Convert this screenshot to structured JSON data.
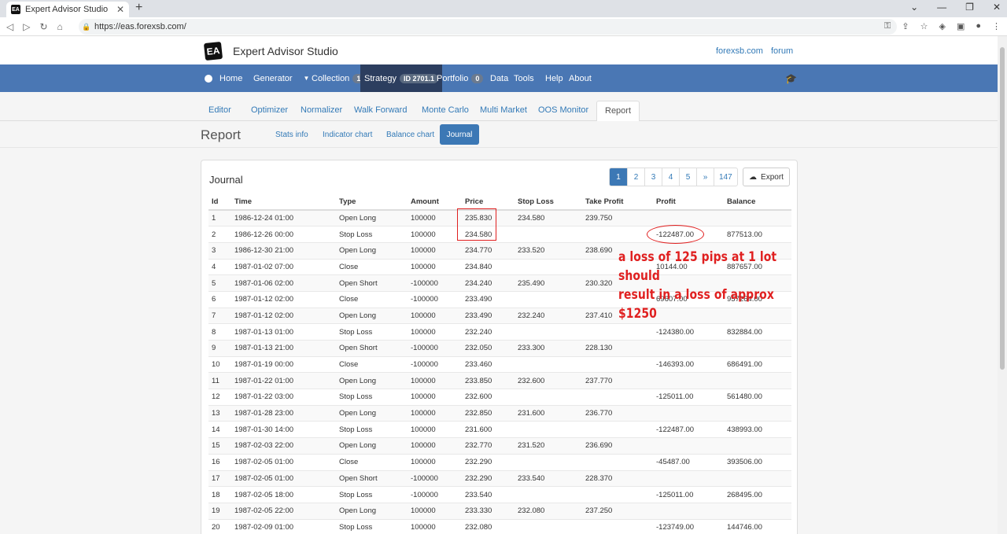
{
  "browser": {
    "tab_title": "Expert Advisor Studio",
    "tab_favicon": "EA",
    "url": "https://eas.forexsb.com/"
  },
  "header": {
    "logo_text": "EA",
    "app_title": "Expert Advisor Studio",
    "links": [
      "forexsb.com",
      "forum"
    ]
  },
  "nav": {
    "home": "Home",
    "generator": "Generator",
    "collection": "Collection",
    "collection_badge": "1",
    "strategy": "Strategy",
    "strategy_badge": "ID 2701.1",
    "portfolio": "Portfolio",
    "portfolio_badge": "0",
    "data": "Data",
    "tools": "Tools",
    "help": "Help",
    "about": "About"
  },
  "subtabs": [
    "Editor",
    "Optimizer",
    "Normalizer",
    "Walk Forward",
    "Monte Carlo",
    "Multi Market",
    "OOS Monitor",
    "Report"
  ],
  "report": {
    "title": "Report",
    "pills": [
      "Stats info",
      "Indicator chart",
      "Balance chart",
      "Journal"
    ]
  },
  "journal": {
    "title": "Journal",
    "pagination": [
      "1",
      "2",
      "3",
      "4",
      "5",
      "»",
      "147"
    ],
    "export_label": "Export",
    "columns": [
      "Id",
      "Time",
      "Type",
      "Amount",
      "Price",
      "Stop Loss",
      "Take Profit",
      "Profit",
      "Balance"
    ],
    "rows": [
      [
        "1",
        "1986-12-24 01:00",
        "Open Long",
        "100000",
        "235.830",
        "234.580",
        "239.750",
        "",
        ""
      ],
      [
        "2",
        "1986-12-26 00:00",
        "Stop Loss",
        "100000",
        "234.580",
        "",
        "",
        "-122487.00",
        "877513.00"
      ],
      [
        "3",
        "1986-12-30 21:00",
        "Open Long",
        "100000",
        "234.770",
        "233.520",
        "238.690",
        "",
        ""
      ],
      [
        "4",
        "1987-01-02 07:00",
        "Close",
        "100000",
        "234.840",
        "",
        "",
        "10144.00",
        "887657.00"
      ],
      [
        "5",
        "1987-01-06 02:00",
        "Open Short",
        "-100000",
        "234.240",
        "235.490",
        "230.320",
        "",
        ""
      ],
      [
        "6",
        "1987-01-12 02:00",
        "Close",
        "-100000",
        "233.490",
        "",
        "",
        "69607.00",
        "957264.00"
      ],
      [
        "7",
        "1987-01-12 02:00",
        "Open Long",
        "100000",
        "233.490",
        "232.240",
        "237.410",
        "",
        ""
      ],
      [
        "8",
        "1987-01-13 01:00",
        "Stop Loss",
        "100000",
        "232.240",
        "",
        "",
        "-124380.00",
        "832884.00"
      ],
      [
        "9",
        "1987-01-13 21:00",
        "Open Short",
        "-100000",
        "232.050",
        "233.300",
        "228.130",
        "",
        ""
      ],
      [
        "10",
        "1987-01-19 00:00",
        "Close",
        "-100000",
        "233.460",
        "",
        "",
        "-146393.00",
        "686491.00"
      ],
      [
        "11",
        "1987-01-22 01:00",
        "Open Long",
        "100000",
        "233.850",
        "232.600",
        "237.770",
        "",
        ""
      ],
      [
        "12",
        "1987-01-22 03:00",
        "Stop Loss",
        "100000",
        "232.600",
        "",
        "",
        "-125011.00",
        "561480.00"
      ],
      [
        "13",
        "1987-01-28 23:00",
        "Open Long",
        "100000",
        "232.850",
        "231.600",
        "236.770",
        "",
        ""
      ],
      [
        "14",
        "1987-01-30 14:00",
        "Stop Loss",
        "100000",
        "231.600",
        "",
        "",
        "-122487.00",
        "438993.00"
      ],
      [
        "15",
        "1987-02-03 22:00",
        "Open Long",
        "100000",
        "232.770",
        "231.520",
        "236.690",
        "",
        ""
      ],
      [
        "16",
        "1987-02-05 01:00",
        "Close",
        "100000",
        "232.290",
        "",
        "",
        "-45487.00",
        "393506.00"
      ],
      [
        "17",
        "1987-02-05 01:00",
        "Open Short",
        "-100000",
        "232.290",
        "233.540",
        "228.370",
        "",
        ""
      ],
      [
        "18",
        "1987-02-05 18:00",
        "Stop Loss",
        "-100000",
        "233.540",
        "",
        "",
        "-125011.00",
        "268495.00"
      ],
      [
        "19",
        "1987-02-05 22:00",
        "Open Long",
        "100000",
        "233.330",
        "232.080",
        "237.250",
        "",
        ""
      ],
      [
        "20",
        "1987-02-09 01:00",
        "Stop Loss",
        "100000",
        "232.080",
        "",
        "",
        "-123749.00",
        "144746.00"
      ]
    ]
  },
  "annotation": {
    "line1": "a loss of 125 pips at 1 lot should",
    "line2": "result in a loss of approx $1250",
    "color": "#e02020"
  },
  "colors": {
    "nav_bg": "#4a77b4",
    "nav_active": "#2c3e5f",
    "primary": "#3c78b5",
    "link": "#337ab7"
  }
}
